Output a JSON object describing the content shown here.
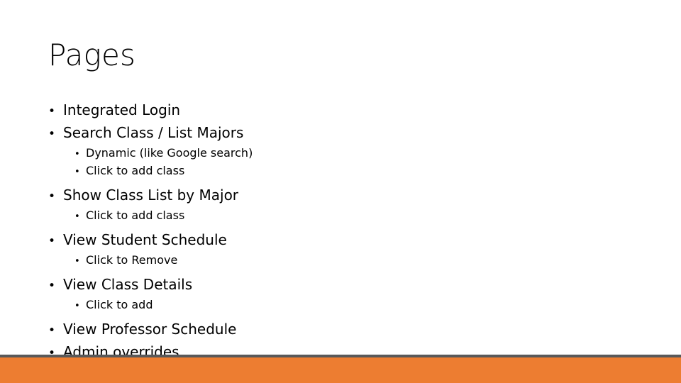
{
  "slide": {
    "title": "Pages",
    "background_color": "#FFFFFF",
    "text_color": "#000000",
    "bullet_glyph": "•",
    "bullets": [
      {
        "level": 1,
        "text": "Integrated Login"
      },
      {
        "level": 1,
        "text": "Search Class / List Majors"
      },
      {
        "level": 2,
        "text": "Dynamic (like Google search)"
      },
      {
        "level": 2,
        "text": "Click to add class"
      },
      {
        "level": 1,
        "text": "Show Class List by Major"
      },
      {
        "level": 2,
        "text": "Click to add class"
      },
      {
        "level": 1,
        "text": "View Student Schedule"
      },
      {
        "level": 2,
        "text": "Click to Remove"
      },
      {
        "level": 1,
        "text": "View Class Details"
      },
      {
        "level": 2,
        "text": "Click to add"
      },
      {
        "level": 1,
        "text": "View Professor Schedule"
      },
      {
        "level": 1,
        "text": "Admin overrides"
      }
    ]
  },
  "footer": {
    "rule_color": "#595959",
    "band_color": "#ED7D31"
  }
}
